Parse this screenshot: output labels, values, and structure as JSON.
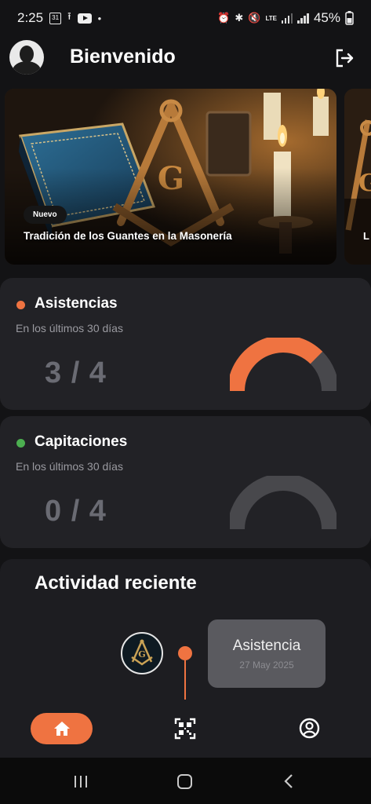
{
  "status_bar": {
    "time": "2:25",
    "calendar_day": "31",
    "network": "LTE",
    "battery": "45%"
  },
  "header": {
    "title": "Bienvenido"
  },
  "carousel": {
    "cards": [
      {
        "badge": "Nuevo",
        "title": "Tradición de los Guantes en la Masonería"
      },
      {
        "title": "L"
      }
    ]
  },
  "stats": [
    {
      "label": "Asistencias",
      "subtitle": "En los últimos 30 días",
      "value": "3 / 4",
      "fraction": 0.75,
      "dot_color": "#ef7341"
    },
    {
      "label": "Capitaciones",
      "subtitle": "En los últimos 30 días",
      "value": "0 / 4",
      "fraction": 0,
      "dot_color": "#4caf50"
    }
  ],
  "activity": {
    "heading": "Actividad reciente",
    "items": [
      {
        "title": "Asistencia",
        "date": "27 May 2025"
      }
    ]
  },
  "colors": {
    "accent": "#ef7341",
    "success": "#4caf50",
    "track": "#48484c"
  },
  "icons": {
    "header_left": "avatar",
    "header_right": "logout-icon",
    "nav": [
      "home-icon",
      "qr-scan-icon",
      "profile-icon"
    ]
  }
}
